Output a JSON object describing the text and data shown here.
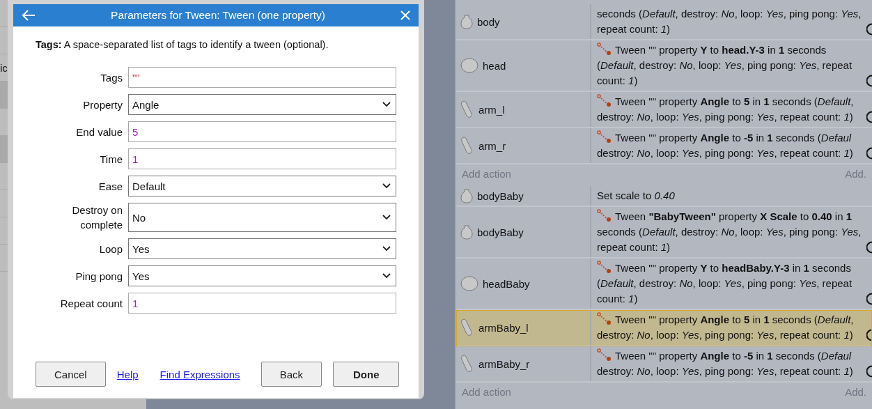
{
  "background": {
    "side_text": "ic"
  },
  "dialog": {
    "title": "Parameters for Tween: Tween (one property)",
    "description": "**Tags:** A space-separated list of tags to identify a tween (optional).",
    "fields": [
      {
        "label": "Tags",
        "kind": "string",
        "value": "\"\""
      },
      {
        "label": "Property",
        "kind": "select",
        "value": "Angle"
      },
      {
        "label": "End value",
        "kind": "number",
        "value": "5"
      },
      {
        "label": "Time",
        "kind": "number",
        "value": "1"
      },
      {
        "label": "Ease",
        "kind": "select",
        "value": "Default"
      },
      {
        "label": "Destroy on complete",
        "kind": "select",
        "value": "No"
      },
      {
        "label": "Loop",
        "kind": "select",
        "value": "Yes"
      },
      {
        "label": "Ping pong",
        "kind": "select",
        "value": "Yes"
      },
      {
        "label": "Repeat count",
        "kind": "number",
        "value": "1"
      }
    ],
    "buttons": [
      {
        "label": "Cancel",
        "kind": "button"
      },
      {
        "label": "Help",
        "kind": "link"
      },
      {
        "label": "Find Expressions",
        "kind": "link"
      },
      {
        "label": "Back",
        "kind": "button"
      },
      {
        "label": "Done",
        "kind": "primary"
      }
    ]
  },
  "event_groups": [
    {
      "rows": [
        {
          "object": {
            "name": "body",
            "kind": "egg"
          },
          "kind": "continued",
          "selected": false,
          "lines": [
            "seconds (*Default*, destroy: *No*, loop: *Yes*, ping pong: *Yes*,",
            "repeat count: *1*)"
          ]
        },
        {
          "object": {
            "name": "head",
            "kind": "round"
          },
          "kind": "tween",
          "selected": false,
          "lines": [
            "Tween \"\" property **Y** to **head.Y-3** in **1** seconds",
            "(*Default*, destroy: *No*, loop: *Yes*, ping pong: *Yes*, repeat",
            "count: *1*)"
          ]
        },
        {
          "object": {
            "name": "arm_l",
            "kind": "arm"
          },
          "kind": "tween",
          "selected": false,
          "lines": [
            "Tween \"\" property **Angle** to **5** in **1** seconds (*Default*,",
            "destroy: *No*, loop: *Yes*, ping pong: *Yes*, repeat count: *1*)"
          ]
        },
        {
          "object": {
            "name": "arm_r",
            "kind": "arm"
          },
          "kind": "tween",
          "selected": false,
          "lines": [
            "Tween \"\" property **Angle** to **-5** in **1** seconds (*Defaul*",
            "destroy: *No*, loop: *Yes*, ping pong: *Yes*, repeat count: *1*)"
          ]
        }
      ],
      "add_action": "Add action",
      "add_other": "Add."
    },
    {
      "rows": [
        {
          "object": {
            "name": "bodyBaby",
            "kind": "egg"
          },
          "kind": "plain",
          "selected": false,
          "lines": [
            "Set scale to *0.40*"
          ]
        },
        {
          "object": {
            "name": "bodyBaby",
            "kind": "egg"
          },
          "kind": "tween",
          "selected": false,
          "lines": [
            "Tween **\"BabyTween\"** property **X Scale** to **0.40** in **1**",
            "seconds (*Default*, destroy: *No*, loop: *Yes*, ping pong: *Yes*,",
            "repeat count: *1*)"
          ]
        },
        {
          "object": {
            "name": "headBaby",
            "kind": "round"
          },
          "kind": "tween",
          "selected": false,
          "lines": [
            "Tween \"\" property **Y** to **headBaby.Y-3** in **1** seconds",
            "(*Default*, destroy: *No*, loop: *Yes*, ping pong: *Yes*, repeat",
            "count: *1*)"
          ]
        },
        {
          "object": {
            "name": "armBaby_l",
            "kind": "arm"
          },
          "kind": "tween",
          "selected": true,
          "lines": [
            "Tween \"\" property **Angle** to **5** in **1** seconds (*Default*,",
            "destroy: *No*, loop: *Yes*, ping pong: *Yes*, repeat count: *1*)"
          ]
        },
        {
          "object": {
            "name": "armBaby_r",
            "kind": "arm"
          },
          "kind": "tween",
          "selected": false,
          "lines": [
            "Tween \"\" property **Angle** to **-5** in **1** seconds (*Defaul*",
            "destroy: *No*, loop: *Yes*, ping pong: *Yes*, repeat count: *1*)"
          ]
        }
      ],
      "add_action": "Add action",
      "add_other": "Add."
    }
  ]
}
